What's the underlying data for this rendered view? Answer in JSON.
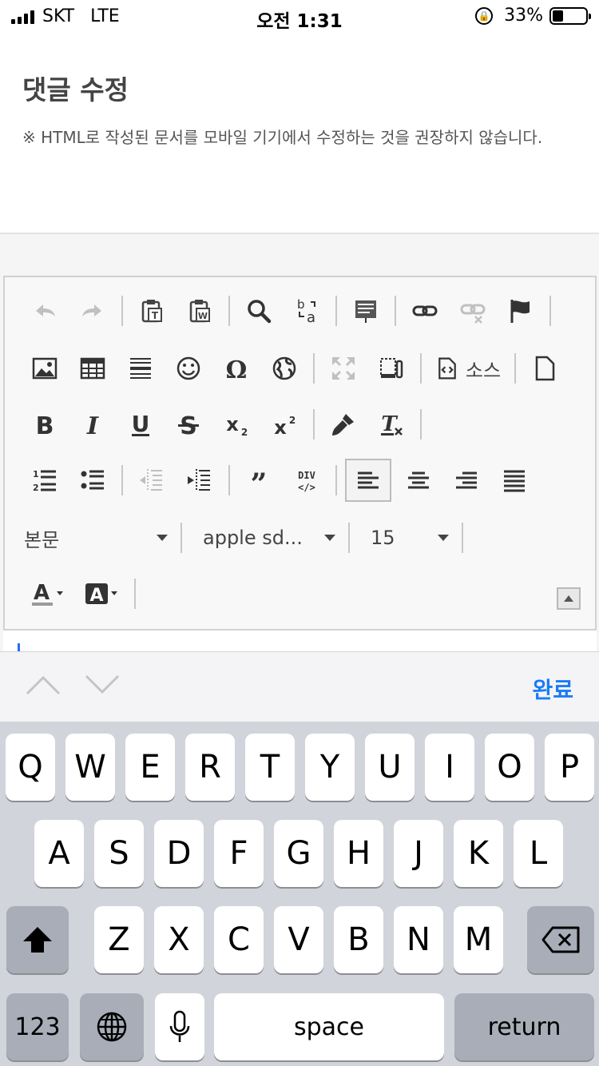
{
  "status_bar": {
    "carrier": "SKT",
    "network": "LTE",
    "time": "오전 1:31",
    "battery": "33%",
    "battery_level": 0.33
  },
  "header": {
    "title": "댓글 수정",
    "notice": "※ HTML로 작성된 문서를 모바일 기기에서 수정하는 것을 권장하지 않습니다."
  },
  "toolbar": {
    "source_label": "소스",
    "format_value": "본문",
    "font_value": "apple sd...",
    "size_value": "15"
  },
  "accessory": {
    "done_label": "완료"
  },
  "keyboard": {
    "row1": [
      "Q",
      "W",
      "E",
      "R",
      "T",
      "Y",
      "U",
      "I",
      "O",
      "P"
    ],
    "row2": [
      "A",
      "S",
      "D",
      "F",
      "G",
      "H",
      "J",
      "K",
      "L"
    ],
    "row3": [
      "Z",
      "X",
      "C",
      "V",
      "B",
      "N",
      "M"
    ],
    "numbers_label": "123",
    "space_label": "space",
    "return_label": "return"
  },
  "colors": {
    "accent": "#1a7cf5",
    "keyboard_bg": "#d1d4da"
  }
}
